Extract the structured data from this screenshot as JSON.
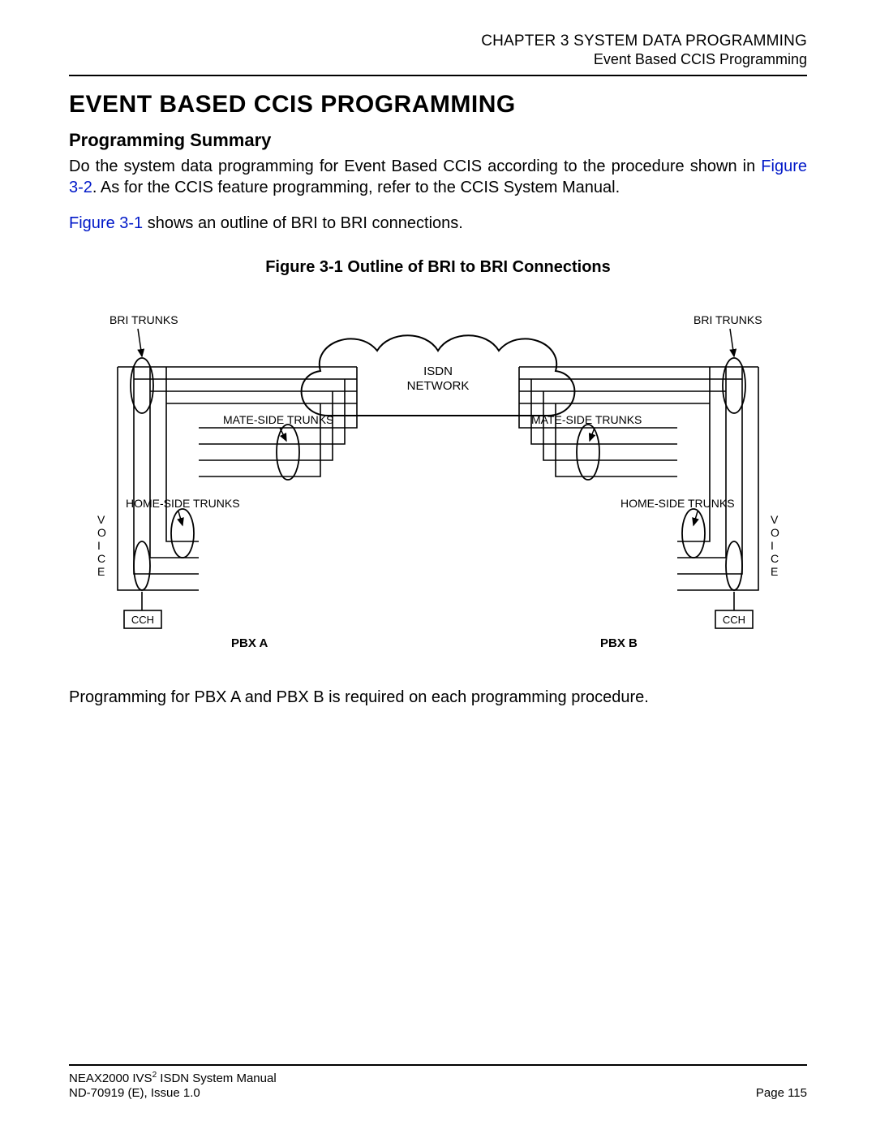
{
  "header": {
    "chapter": "CHAPTER 3  SYSTEM DATA PROGRAMMING",
    "section": "Event Based CCIS Programming"
  },
  "title": "EVENT BASED CCIS PROGRAMMING",
  "subtitle": "Programming Summary",
  "para1_a": "Do the system data programming for Event Based CCIS according to the procedure shown in ",
  "para1_link1": "Figure 3-2",
  "para1_b": ". As for the CCIS feature programming, refer to the CCIS System Manual.",
  "para2_link": "Figure 3-1",
  "para2_rest": " shows an outline of BRI to BRI connections.",
  "figure_caption": "Figure 3-1  Outline of BRI to BRI Connections",
  "diagram": {
    "bri_trunks": "BRI TRUNKS",
    "isdn_network_l1": "ISDN",
    "isdn_network_l2": "NETWORK",
    "mate_side": "MATE-SIDE TRUNKS",
    "home_side": "HOME-SIDE TRUNKS",
    "voice": "VOICE",
    "cch": "CCH",
    "pbx_a": "PBX A",
    "pbx_b": "PBX B"
  },
  "para3": "Programming for PBX A and PBX B is required on each programming procedure.",
  "footer": {
    "line1_a": "NEAX2000 IVS",
    "line1_sup": "2",
    "line1_b": " ISDN System Manual",
    "line2": "ND-70919 (E), Issue 1.0",
    "page": "Page 115"
  },
  "chart_data": {
    "type": "diagram",
    "description": "Outline of BRI to BRI Connections: two PBX systems (PBX A on left, PBX B on right) each with a CCH block, VOICE paths, HOME-SIDE TRUNKS and MATE-SIDE TRUNKS looping through BRI TRUNKS into a central ISDN NETWORK cloud. Four parallel trunk paths per side are shown with arrow-callouts to BRI TRUNKS, MATE-SIDE TRUNKS and HOME-SIDE TRUNKS.",
    "nodes": [
      "PBX A",
      "PBX B",
      "ISDN NETWORK",
      "CCH (A)",
      "CCH (B)"
    ],
    "labels": [
      "BRI TRUNKS",
      "MATE-SIDE TRUNKS",
      "HOME-SIDE TRUNKS",
      "VOICE"
    ]
  }
}
